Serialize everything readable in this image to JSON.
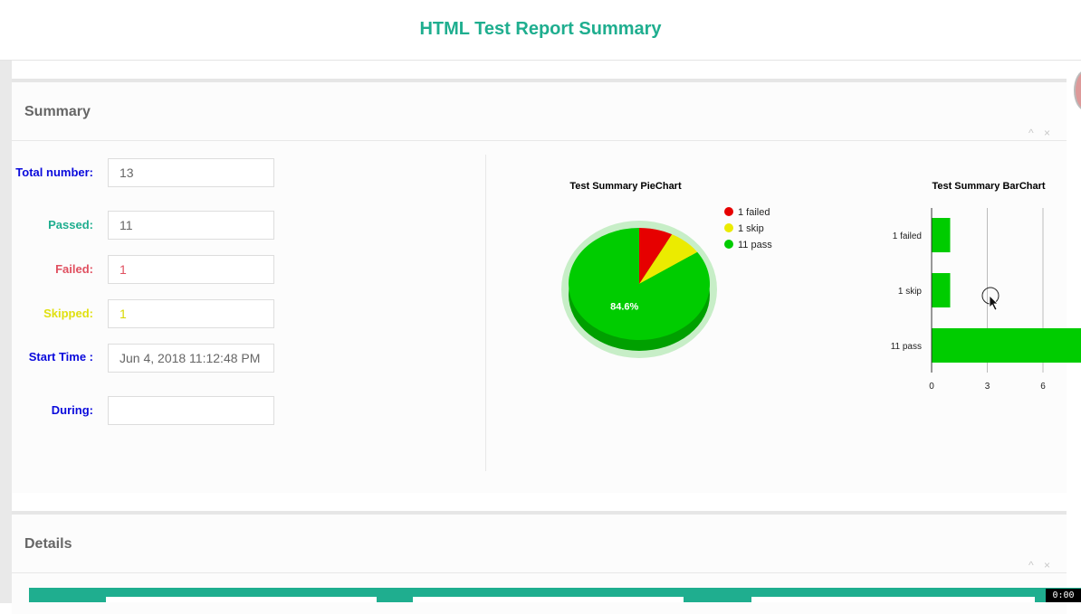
{
  "header": {
    "title": "HTML Test Report Summary"
  },
  "summary_panel": {
    "title": "Summary",
    "controls": {
      "collapse": "^",
      "close": "×"
    },
    "fields": {
      "total_label": "Total number:",
      "total_value": "13",
      "passed_label": "Passed:",
      "passed_value": "11",
      "failed_label": "Failed:",
      "failed_value": "1",
      "skipped_label": "Skipped:",
      "skipped_value": "1",
      "start_label": "Start Time :",
      "start_value": "Jun 4, 2018 11:12:48 PM",
      "during_label": "During:",
      "during_value": ""
    }
  },
  "details_panel": {
    "title": "Details",
    "controls": {
      "collapse": "^",
      "close": "×"
    }
  },
  "video_time": "0:00",
  "colors": {
    "accent": "#1fae8f",
    "failed": "#e60000",
    "skip": "#ebeb00",
    "pass": "#00cc00"
  },
  "chart_data": [
    {
      "type": "pie",
      "title": "Test Summary PieChart",
      "labels": [
        "1 failed",
        "1 skip",
        "11 pass"
      ],
      "values": [
        1,
        1,
        11
      ],
      "colors": [
        "#e60000",
        "#ebeb00",
        "#00cc00"
      ],
      "data_labels": [
        "",
        "",
        "84.6%"
      ],
      "legend_position": "right"
    },
    {
      "type": "bar",
      "orientation": "horizontal",
      "title": "Test Summary BarChart",
      "categories": [
        "1 failed",
        "1 skip",
        "11 pass"
      ],
      "values": [
        1,
        1,
        11
      ],
      "color": "#00cc00",
      "xlim": [
        0,
        9
      ],
      "x_ticks": [
        "0",
        "3",
        "6"
      ],
      "grid": true
    }
  ]
}
